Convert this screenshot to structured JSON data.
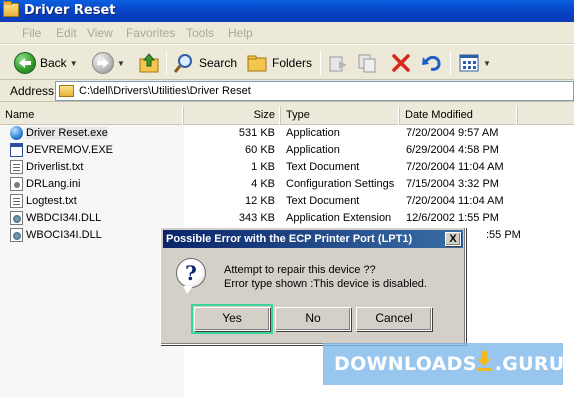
{
  "window": {
    "title": "Driver Reset"
  },
  "menu": [
    "File",
    "Edit",
    "View",
    "Favorites",
    "Tools",
    "Help"
  ],
  "toolbar": {
    "back_label": "Back",
    "search_label": "Search",
    "folders_label": "Folders"
  },
  "address": {
    "label": "Address",
    "path": "C:\\dell\\Drivers\\Utilities\\Driver Reset"
  },
  "columns": {
    "name": "Name",
    "size": "Size",
    "type": "Type",
    "modified": "Date Modified"
  },
  "files": [
    {
      "name": "Driver Reset.exe",
      "size": "531 KB",
      "type": "Application",
      "modified": "7/20/2004 9:57 AM",
      "icon": "globe-exe-icon"
    },
    {
      "name": "DEVREMOV.EXE",
      "size": "60 KB",
      "type": "Application",
      "modified": "6/29/2004 4:58 PM",
      "icon": "window-exe-icon"
    },
    {
      "name": "Driverlist.txt",
      "size": "1 KB",
      "type": "Text Document",
      "modified": "7/20/2004 11:04 AM",
      "icon": "text-file-icon"
    },
    {
      "name": "DRLang.ini",
      "size": "4 KB",
      "type": "Configuration Settings",
      "modified": "7/15/2004 3:32 PM",
      "icon": "ini-file-icon"
    },
    {
      "name": "Logtest.txt",
      "size": "12 KB",
      "type": "Text Document",
      "modified": "7/20/2004 11:04 AM",
      "icon": "text-file-icon"
    },
    {
      "name": "WBDCI34I.DLL",
      "size": "343 KB",
      "type": "Application Extension",
      "modified": "12/6/2002 1:55 PM",
      "icon": "dll-file-icon"
    },
    {
      "name": "WBOCI34I.DLL",
      "size": "",
      "type": "",
      "modified": ":55 PM",
      "icon": "dll-file-icon"
    }
  ],
  "dialog": {
    "title": "Possible Error with the ECP Printer Port (LPT1)",
    "close_label": "X",
    "message_line1": "Attempt to repair this device ??",
    "message_line2": "Error type shown :This device is disabled.",
    "yes_label": "Yes",
    "no_label": "No",
    "cancel_label": "Cancel"
  },
  "watermark": {
    "text_left": "DOWNLOADS",
    "text_right": ".GURU"
  },
  "colors": {
    "title_bar": "#0842c4",
    "dialog_title": "#0a246a",
    "watermark_bg": "#82b9eb",
    "default_focus": "#3ad39a"
  }
}
